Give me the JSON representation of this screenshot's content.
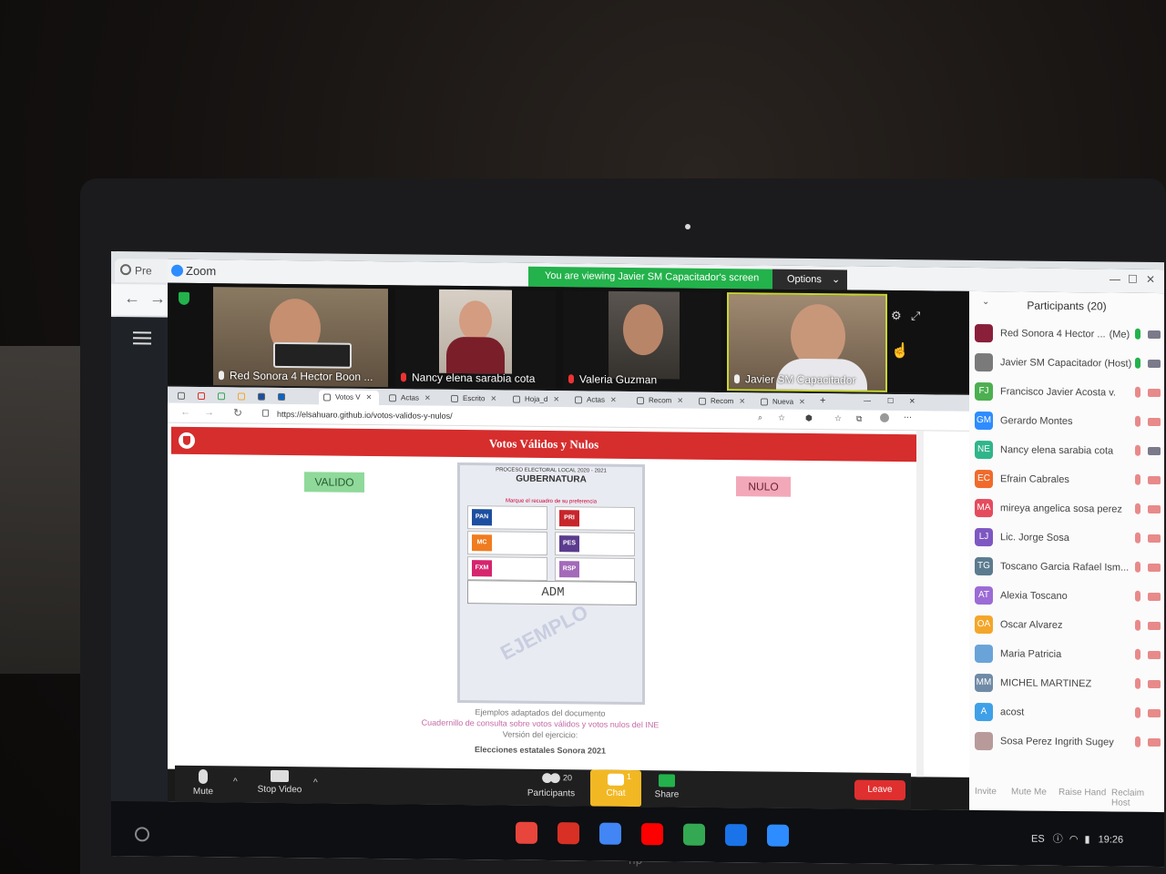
{
  "bg_browser": {
    "tab_label": "Pre"
  },
  "zoom": {
    "title": "Zoom",
    "banner": "You are viewing Javier SM Capacitador's screen",
    "options_label": "Options",
    "videos": [
      {
        "name": "Red Sonora 4 Hector Boon ...",
        "muted": false
      },
      {
        "name": "Nancy elena sarabia cota",
        "muted": true
      },
      {
        "name": "Valeria Guzman",
        "muted": true
      },
      {
        "name": "Javier SM Capacitador",
        "muted": false
      }
    ],
    "toolbar": {
      "mute": "Mute",
      "stop_video": "Stop Video",
      "participants": "Participants",
      "participants_count": "20",
      "chat": "Chat",
      "chat_count": "1",
      "share": "Share",
      "leave": "Leave"
    }
  },
  "browser": {
    "tabs": [
      "",
      "",
      "",
      "",
      "",
      "",
      "Votos V",
      "Actas",
      "Escrito",
      "Hoja_d",
      "Actas",
      "Recom",
      "Recom",
      "Nueva"
    ],
    "url": "https://elsahuaro.github.io/votos-validos-y-nulos/"
  },
  "page": {
    "title": "Votos Válidos y Nulos",
    "valido_label": "VALIDO",
    "nulo_label": "NULO",
    "ballot": {
      "header": "PROCESO ELECTORAL LOCAL 2020 - 2021",
      "title": "GUBERNATURA",
      "instruction": "Marque el recuadro de su preferencia",
      "write_in": "ADM",
      "watermark": "EJEMPLO",
      "parties": [
        {
          "logo": "PAN",
          "color": "#1c4fa0"
        },
        {
          "logo": "PRI",
          "color": "#c7252c"
        },
        {
          "logo": "MC",
          "color": "#f07c20"
        },
        {
          "logo": "PES",
          "color": "#5b3c8e"
        },
        {
          "logo": "FXM",
          "color": "#d6246e"
        },
        {
          "logo": "RSP",
          "color": "#a36ab9"
        }
      ]
    },
    "footer_line1": "Ejemplos adaptados del documento",
    "footer_link": "Cuadernillo de consulta sobre votos válidos y votos nulos del INE",
    "footer_line3": "Versión del ejercicio:",
    "footer_last": "Elecciones estatales Sonora 2021"
  },
  "participants": {
    "title": "Participants (20)",
    "list": [
      {
        "initials": "",
        "name": "Red Sonora 4 Hector ...",
        "tag": "(Me)",
        "color": "#8a1f3a",
        "mic_on": true,
        "cam_on": true
      },
      {
        "initials": "",
        "name": "Javier SM Capacitador (Host)",
        "tag": "",
        "color": "#7a7a7a",
        "mic_on": true,
        "cam_on": true
      },
      {
        "initials": "FJ",
        "name": "Francisco Javier Acosta v.",
        "tag": "",
        "color": "#4caf50",
        "mic_on": false,
        "cam_on": false
      },
      {
        "initials": "GM",
        "name": "Gerardo Montes",
        "tag": "",
        "color": "#2d8cff",
        "mic_on": false,
        "cam_on": false
      },
      {
        "initials": "NE",
        "name": "Nancy elena sarabia cota",
        "tag": "",
        "color": "#2fb58a",
        "mic_on": false,
        "cam_on": true
      },
      {
        "initials": "EC",
        "name": "Efrain Cabrales",
        "tag": "",
        "color": "#f06a2b",
        "mic_on": false,
        "cam_on": false
      },
      {
        "initials": "MA",
        "name": "mireya angelica sosa perez",
        "tag": "",
        "color": "#e54b5e",
        "mic_on": false,
        "cam_on": false
      },
      {
        "initials": "LJ",
        "name": "Lic. Jorge Sosa",
        "tag": "",
        "color": "#7e57c2",
        "mic_on": false,
        "cam_on": false
      },
      {
        "initials": "TG",
        "name": "Toscano Garcia Rafael Ism...",
        "tag": "",
        "color": "#5c7b8e",
        "mic_on": false,
        "cam_on": false
      },
      {
        "initials": "AT",
        "name": "Alexia Toscano",
        "tag": "",
        "color": "#9c6bd6",
        "mic_on": false,
        "cam_on": false
      },
      {
        "initials": "OA",
        "name": "Oscar Alvarez",
        "tag": "",
        "color": "#f4a62a",
        "mic_on": false,
        "cam_on": false
      },
      {
        "initials": "",
        "name": "Maria Patricia",
        "tag": "",
        "color": "#6aa3d8",
        "mic_on": false,
        "cam_on": false
      },
      {
        "initials": "MM",
        "name": "MICHEL MARTINEZ",
        "tag": "",
        "color": "#6f8aa6",
        "mic_on": false,
        "cam_on": false
      },
      {
        "initials": "A",
        "name": "acost",
        "tag": "",
        "color": "#3fa0e8",
        "mic_on": false,
        "cam_on": false
      },
      {
        "initials": "",
        "name": "Sosa Perez Ingrith Sugey",
        "tag": "",
        "color": "#b89a9a",
        "mic_on": false,
        "cam_on": false
      }
    ],
    "actions": [
      "Invite",
      "Mute Me",
      "Raise Hand",
      "Reclaim Host"
    ]
  },
  "shelf": {
    "apps": [
      {
        "name": "chrome-icon",
        "color": "#e8453c"
      },
      {
        "name": "gmail-icon",
        "color": "#d93025"
      },
      {
        "name": "docs-icon",
        "color": "#4285f4"
      },
      {
        "name": "youtube-icon",
        "color": "#ff0000"
      },
      {
        "name": "play-store-icon",
        "color": "#34a853"
      },
      {
        "name": "files-icon",
        "color": "#1a73e8"
      },
      {
        "name": "zoom-icon",
        "color": "#2d8cff"
      }
    ],
    "locale": "ES",
    "time": "19:26"
  }
}
